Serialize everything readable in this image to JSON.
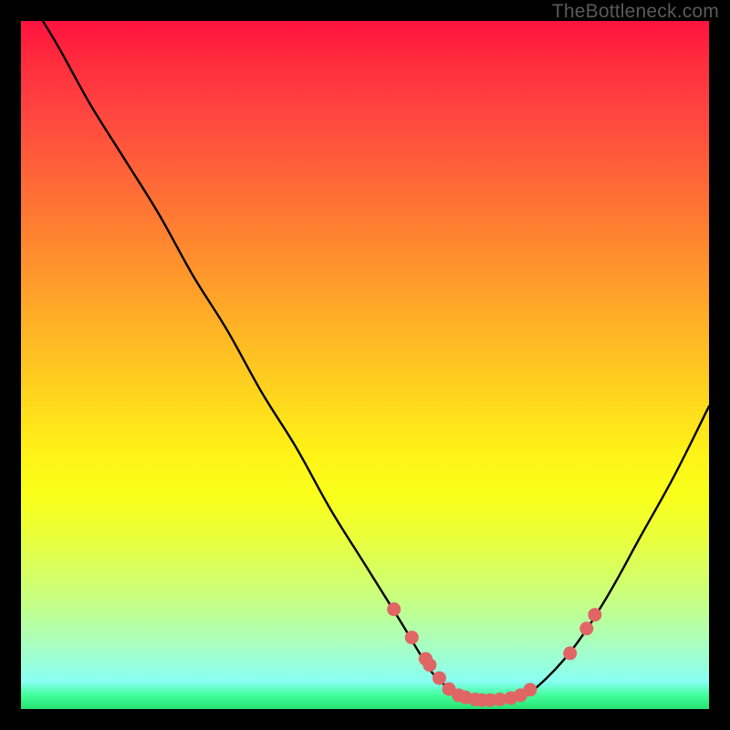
{
  "watermark": "TheBottleneck.com",
  "colors": {
    "background": "#000000",
    "curve": "#000000",
    "dot_fill": "#e06666",
    "dot_stroke": "#c94f4f",
    "gradient": {
      "top": "#ff123f",
      "mid": "#ffe018",
      "bottom": "#27e170"
    }
  },
  "chart_data": {
    "type": "line",
    "title": "",
    "xlabel": "",
    "ylabel": "",
    "xlim": [
      0,
      100
    ],
    "ylim": [
      0,
      100
    ],
    "series": [
      {
        "name": "bottleneck-curve",
        "x": [
          0,
          5,
          10,
          15,
          20,
          25,
          30,
          35,
          40,
          45,
          50,
          55,
          58,
          60,
          63,
          66,
          68,
          72,
          75,
          80,
          85,
          90,
          95,
          100
        ],
        "y": [
          105,
          97,
          88,
          80,
          72,
          63,
          55,
          46,
          38,
          29,
          21,
          13,
          8,
          5,
          2.5,
          1.5,
          1.2,
          1.6,
          3.2,
          8.5,
          16,
          25,
          34,
          44
        ]
      }
    ],
    "scatter_points": {
      "name": "highlight-dots",
      "x": [
        54.2,
        56.8,
        58.8,
        59.4,
        60.8,
        62.2,
        63.6,
        64.6,
        66.0,
        67.0,
        68.2,
        69.6,
        71.2,
        72.6,
        74.0,
        79.8,
        82.2,
        83.4
      ],
      "y": [
        14.5,
        10.4,
        7.3,
        6.4,
        4.5,
        2.9,
        2.0,
        1.7,
        1.4,
        1.3,
        1.3,
        1.4,
        1.6,
        2.0,
        2.8,
        8.1,
        11.7,
        13.7
      ]
    }
  }
}
